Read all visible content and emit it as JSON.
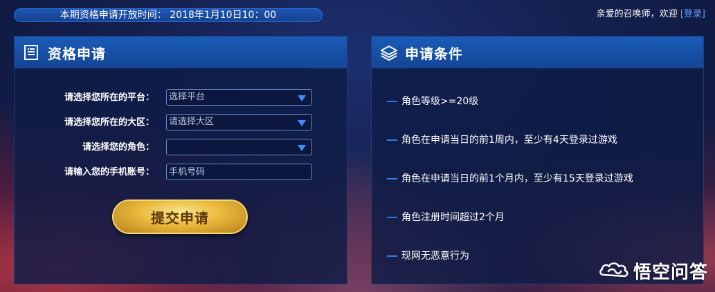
{
  "top_bar": {
    "time_text": "本期资格申请开放时间： 2018年1月10日10：00",
    "greeting": "亲爱的召唤师，欢迎",
    "login_bracket_open": "[",
    "login_label": "登录",
    "login_bracket_close": "]"
  },
  "apply_panel": {
    "title": "资格申请",
    "icon": "document-list-icon",
    "fields": [
      {
        "label": "请选择您所在的平台：",
        "value": "选择平台",
        "type": "select"
      },
      {
        "label": "请选择您所在的大区：",
        "value": "请选择大区",
        "type": "select"
      },
      {
        "label": "请选择您的角色：",
        "value": "",
        "type": "select"
      },
      {
        "label": "请输入您的手机账号：",
        "placeholder": "手机号码",
        "type": "input"
      }
    ],
    "submit_label": "提交申请"
  },
  "conditions_panel": {
    "title": "申请条件",
    "icon": "layers-icon",
    "items": [
      "角色等级>=20级",
      "角色在申请当日的前1周内，至少有4天登录过游戏",
      "角色在申请当日的前1个月内，至少有15天登录过游戏",
      "角色注册时间超过2个月",
      "现网无恶意行为"
    ]
  },
  "watermark": {
    "text": "悟空问答",
    "icon": "wukong-cloud-icon"
  },
  "colors": {
    "accent_blue": "#1a5bb8",
    "link_blue": "#5aa0ff",
    "button_gold": "#e9b93c"
  }
}
